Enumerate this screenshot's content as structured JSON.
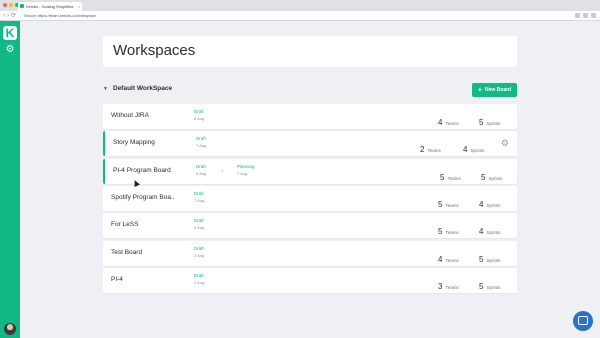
{
  "browser": {
    "tab_title": "Kendis - Scaling Simplified",
    "url_secure": "Secure",
    "url": "https://team.kendis.io/workspace",
    "colors": {
      "close": "#ff5f57",
      "minimize": "#febc2e",
      "maximize": "#28c840"
    }
  },
  "sidebar": {
    "logo_letter": "K",
    "settings_icon": "gear-icon"
  },
  "page": {
    "title": "Workspaces"
  },
  "workspace": {
    "name": "Default WorkSpace",
    "new_board_label": "New Board"
  },
  "labels": {
    "teams": "Teams",
    "sprints": "Sprints"
  },
  "boards": [
    {
      "name": "Without JIRA",
      "phase1": {
        "name": "Draft",
        "date": "8 Aug"
      },
      "teams": "4",
      "sprints": "5",
      "active": false
    },
    {
      "name": "Story Mapping",
      "phase1": {
        "name": "Draft",
        "date": "7 Aug"
      },
      "teams": "2",
      "sprints": "4",
      "active": true
    },
    {
      "name": "PI-4 Program Board",
      "phase1": {
        "name": "Draft",
        "date": "6 Aug"
      },
      "phase2": {
        "name": "Planning",
        "date": "7 Aug"
      },
      "teams": "5",
      "sprints": "5",
      "active": true
    },
    {
      "name": "Spotify Program Boa..",
      "phase1": {
        "name": "Draft",
        "date": "7 Aug"
      },
      "teams": "5",
      "sprints": "4",
      "active": false
    },
    {
      "name": "For LeSS",
      "phase1": {
        "name": "Draft",
        "date": "6 Aug"
      },
      "teams": "5",
      "sprints": "4",
      "active": false
    },
    {
      "name": "Test Board",
      "phase1": {
        "name": "Draft",
        "date": "2 Aug"
      },
      "teams": "4",
      "sprints": "5",
      "active": false
    },
    {
      "name": "PI-4",
      "phase1": {
        "name": "Draft",
        "date": "2 Aug"
      },
      "teams": "3",
      "sprints": "5",
      "active": false
    }
  ],
  "colors": {
    "accent": "#12b886",
    "chat": "#2b70c9"
  }
}
